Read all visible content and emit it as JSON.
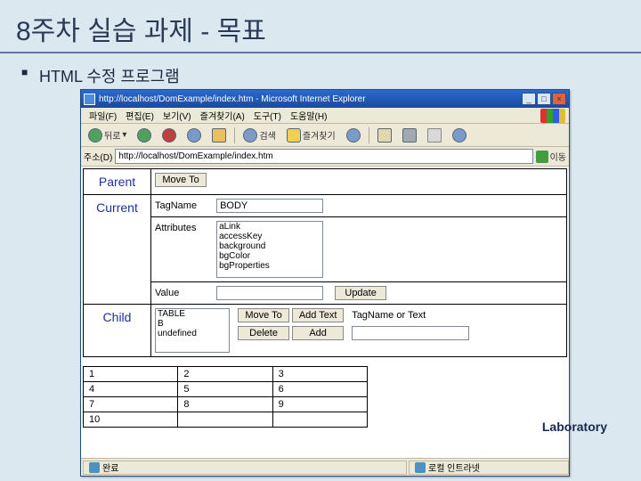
{
  "slide": {
    "title": "8주차 실습 과제 - 목표",
    "bullet": "HTML 수정 프로그램"
  },
  "ie": {
    "title": "http://localhost/DomExample/index.htm - Microsoft Internet Explorer",
    "menu": {
      "file": "파일(F)",
      "edit": "편집(E)",
      "view": "보기(V)",
      "favorites": "즐겨찾기(A)",
      "tools": "도구(T)",
      "help": "도움말(H)"
    },
    "toolbar": {
      "back": "뒤로",
      "search": "검색",
      "favorites": "즐겨찾기"
    },
    "address": {
      "label": "주소(D)",
      "value": "http://localhost/DomExample/index.htm",
      "go": "이동"
    },
    "status": {
      "done": "완료",
      "zone": "로컬 인트라넷"
    }
  },
  "app": {
    "parent": {
      "label": "Parent",
      "moveTo": "Move To"
    },
    "current": {
      "label": "Current",
      "tagNameLabel": "TagName",
      "tagNameValue": "BODY",
      "attrLabel": "Attributes",
      "attrs": [
        "aLink",
        "accessKey",
        "background",
        "bgColor",
        "bgProperties"
      ],
      "valueLabel": "Value",
      "valueValue": "",
      "update": "Update"
    },
    "child": {
      "label": "Child",
      "items": [
        "TABLE",
        "B",
        "undefined"
      ],
      "moveTo": "Move To",
      "addText": "Add Text",
      "tagHint": "TagName or Text",
      "delete": "Delete",
      "add": "Add"
    },
    "table": [
      [
        "1",
        "2",
        "3"
      ],
      [
        "4",
        "5",
        "6"
      ],
      [
        "7",
        "8",
        "9"
      ],
      [
        "10",
        "",
        ""
      ]
    ]
  },
  "footer": "Laboratory"
}
